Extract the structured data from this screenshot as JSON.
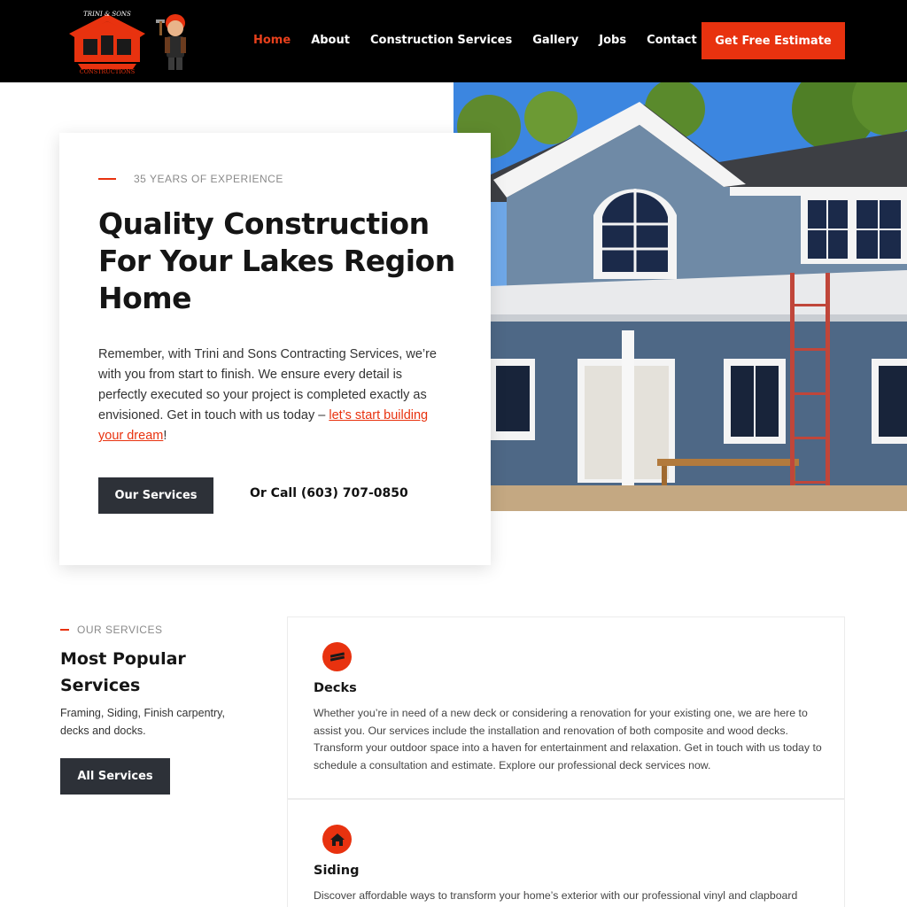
{
  "header": {
    "brand": "TRINI & SONS CONSTRUCTIONS",
    "nav": [
      "Home",
      "About",
      "Construction Services",
      "Gallery",
      "Jobs",
      "Contact"
    ],
    "active_nav": "Home",
    "cta_label": "Get Free Estimate"
  },
  "hero": {
    "kicker": "35 YEARS OF EXPERIENCE",
    "title": "Quality Construction For Your Lakes Region Home",
    "text_before_link": "Remember, with Trini and Sons Contracting Services, we’re with you from start to finish. We ensure every detail is perfectly executed so your project is completed exactly as envisioned. Get in touch with us today – ",
    "link_text": "let’s start building your dream",
    "text_after_link": "!",
    "button_label": "Our Services",
    "call_text": "Or Call (603) 707-0850"
  },
  "services": {
    "kicker": "OUR SERVICES",
    "title": "Most Popular Services",
    "description": "Framing, Siding, Finish carpentry, decks and docks.",
    "button_label": "All Services",
    "items": [
      {
        "name": "Decks",
        "icon": "deck-icon",
        "body": "Whether you’re in need of a new deck or considering a renovation for your existing one, we are here to assist you. Our services include the installation and renovation of both composite and wood decks. Transform your outdoor space into a haven for entertainment and relaxation. Get in touch with us today to schedule a consultation and estimate. Explore our professional deck services now."
      },
      {
        "name": "Siding",
        "icon": "house-icon",
        "body": "Discover affordable ways to transform your home’s exterior with our professional vinyl and clapboard"
      }
    ]
  },
  "colors": {
    "accent": "#e8320f",
    "dark_button": "#2d3138",
    "header_bg": "#000000"
  }
}
